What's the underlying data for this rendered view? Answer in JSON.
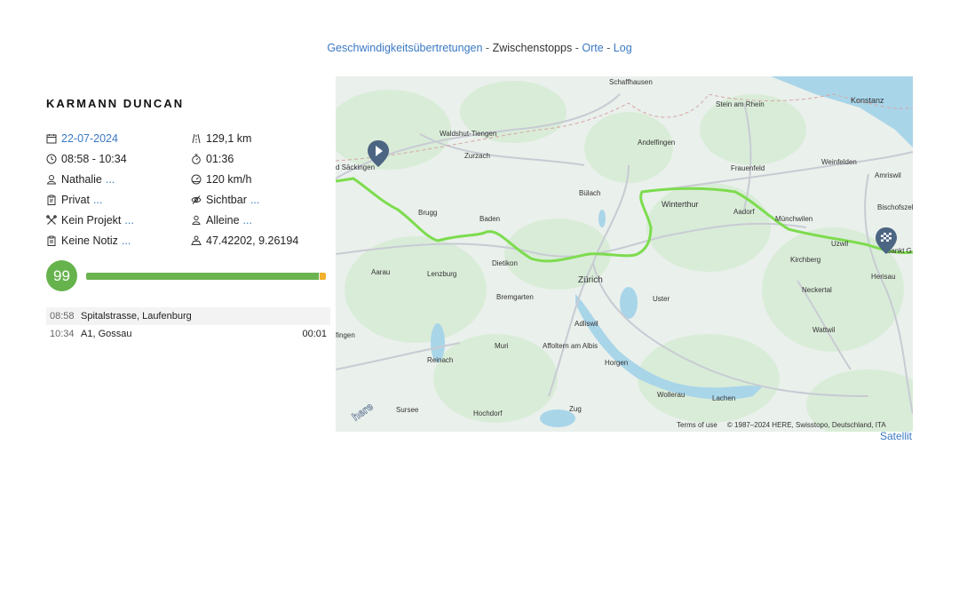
{
  "nav": {
    "speeding": "Geschwindigkeitsübertretungen",
    "stops": "Zwischenstopps",
    "places": "Orte",
    "log": "Log",
    "sep": "-"
  },
  "driver": {
    "name": "KARMANN DUNCAN"
  },
  "trip": {
    "date": "22-07-2024",
    "time_range": "08:58 - 10:34",
    "person": "Nathalie",
    "type": "Privat",
    "project": "Kein Projekt",
    "note": "Keine Notiz",
    "distance": "129,1 km",
    "duration": "01:36",
    "max_speed": "120 km/h",
    "visibility": "Sichtbar",
    "company": "Alleine",
    "coordinates": "47.42202, 9.26194",
    "more": "..."
  },
  "score": {
    "value": "99",
    "fraction": 0.97
  },
  "stops": [
    {
      "time": "08:58",
      "place": "Spitalstrasse, Laufenburg",
      "duration": ""
    },
    {
      "time": "10:34",
      "place": "A1, Gossau",
      "duration": "00:01"
    }
  ],
  "map": {
    "labels": [
      "Schaffhausen",
      "Stein am Rhein",
      "Konstanz",
      "Waldshut-Tiengen",
      "Zurzach",
      "Andelfingen",
      "Frauenfeld",
      "Weinfelden",
      "Amriswil",
      "Bülach",
      "Winterthur",
      "Aadorf",
      "Münchwilen",
      "Bischofszell",
      "Brugg",
      "Baden",
      "Uzwil",
      "Sankt G",
      "Kirchberg",
      "Dietikon",
      "Zürich",
      "Aarau",
      "Lenzburg",
      "Bremgarten",
      "Uster",
      "Neckertal",
      "Herisau",
      "Wattwil",
      "Adliswil",
      "Muri",
      "Affoltern am Albis",
      "Horgen",
      "Reinach",
      "Sursee",
      "Hochdorf",
      "Zug",
      "Wollerau",
      "Lachen",
      "d Säckingen",
      "fingen"
    ],
    "attribution": "Terms of use",
    "copyright": "© 1987–2024 HERE, Swisstopo, Deutschland, ITA",
    "satellite_label": "Satellit",
    "logo": "here"
  },
  "colors": {
    "accent": "#3a78c3",
    "score": "#66b34d",
    "route": "#7ddc4e",
    "pin": "#4b6582"
  }
}
